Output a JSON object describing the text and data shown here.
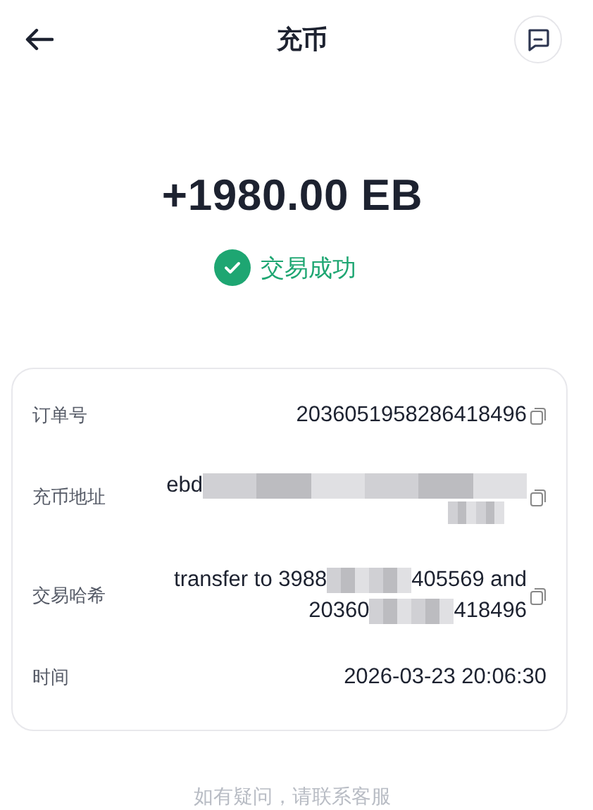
{
  "header": {
    "title": "充币"
  },
  "amount": "+1980.00 EB",
  "status": {
    "text": "交易成功",
    "success": true
  },
  "details": [
    {
      "label": "订单号",
      "copyable": true,
      "lines": [
        [
          {
            "kind": "text",
            "text": "2036051958286418496"
          }
        ]
      ]
    },
    {
      "label": "充币地址",
      "copyable": true,
      "lines": [
        [
          {
            "kind": "text",
            "text": "ebd"
          },
          {
            "kind": "redacted"
          }
        ],
        [
          {
            "kind": "redacted"
          }
        ]
      ]
    },
    {
      "label": "交易哈希",
      "copyable": true,
      "lines": [
        [
          {
            "kind": "text",
            "text": "transfer to 3988"
          },
          {
            "kind": "redacted"
          },
          {
            "kind": "text",
            "text": "405569 and"
          }
        ],
        [
          {
            "kind": "text",
            "text": "20360"
          },
          {
            "kind": "redacted"
          },
          {
            "kind": "text",
            "text": "418496"
          }
        ]
      ]
    },
    {
      "label": "时间",
      "copyable": false,
      "lines": [
        [
          {
            "kind": "text",
            "text": "2026-03-23 20:06:30"
          }
        ]
      ]
    }
  ],
  "footer": "如有疑问，请联系客服"
}
